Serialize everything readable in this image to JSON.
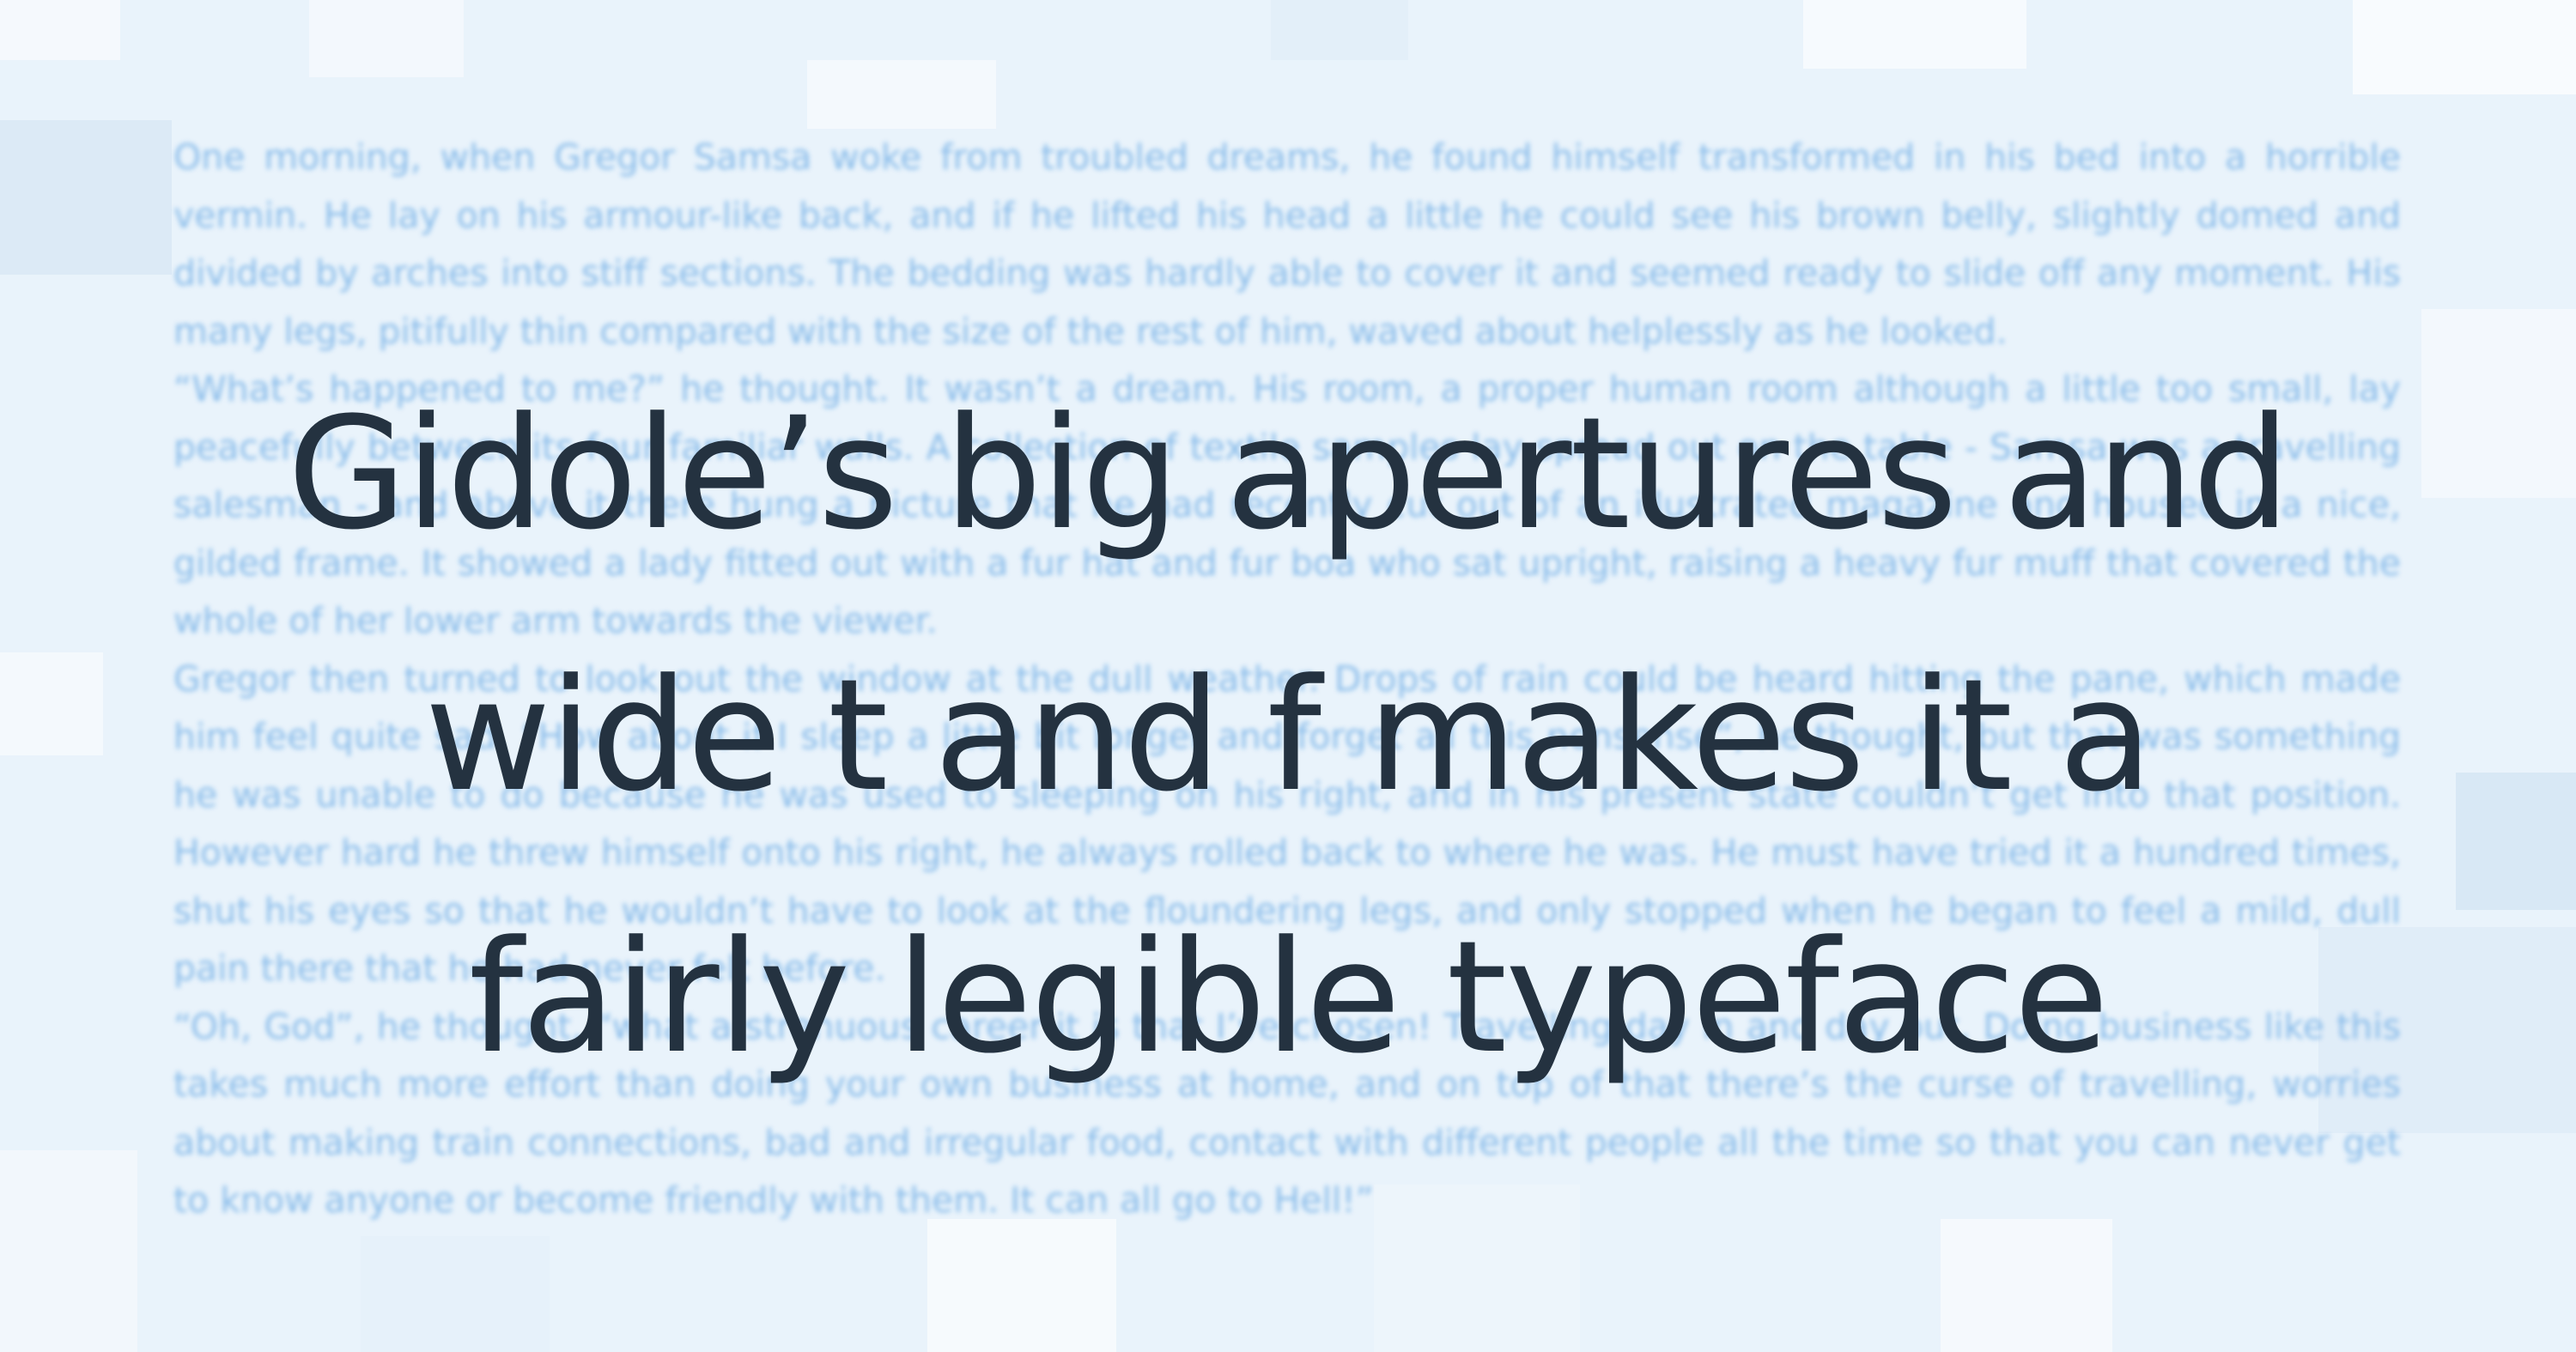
{
  "headline": {
    "line1": "Gidole’s big apertures and",
    "line2": "wide t and f makes it a",
    "line3": "fairly legible typeface"
  },
  "background_text": {
    "paragraphs": [
      "One morning, when Gregor Samsa woke from troubled dreams, he found himself transformed in his bed into a horrible vermin. He lay on his armour-like back, and if he lifted his head a little he could see his brown belly, slightly domed and divided by arches into stiff sections. The bedding was hardly able to cover it and seemed ready to slide off any moment. His many legs, pitifully thin compared with the size of the rest of him, waved about helplessly as he looked.",
      "“What’s happened to me?” he thought. It wasn’t a dream. His room, a proper human room although a little too small, lay peacefully between its four familiar walls. A collection of textile samples lay spread out on the table - Samsa was a travelling salesman - and above it there hung a picture that he had recently cut out of an illustrated magazine and housed in a nice, gilded frame. It showed a lady fitted out with a fur hat and fur boa who sat upright, raising a heavy fur muff that covered the whole of her lower arm towards the viewer.",
      "Gregor then turned to look out the window at the dull weather. Drops of rain could be heard hitting the pane, which made him feel quite sad. “How about if I sleep a little bit longer and forget all this nonsense”, he thought, but that was something he was unable to do because he was used to sleeping on his right, and in his present state couldn’t get into that position. However hard he threw himself onto his right, he always rolled back to where he was. He must have tried it a hundred times, shut his eyes so that he wouldn’t have to look at the floundering legs, and only stopped when he began to feel a mild, dull pain there that he had never felt before.",
      "“Oh, God”, he thought, “what a strenuous career it is that I’ve chosen! Travelling day in and day out. Doing business like this takes much more effort than doing your own business at home, and on top of that there’s the curse of travelling, worries about making train connections, bad and irregular food, contact with different people all the time so that you can never get to know anyone or become friendly with them. It can all go to Hell!”"
    ]
  },
  "colors": {
    "background": "#e9f3fb",
    "headline": "#243240",
    "background_text": "#7fb6e8"
  }
}
